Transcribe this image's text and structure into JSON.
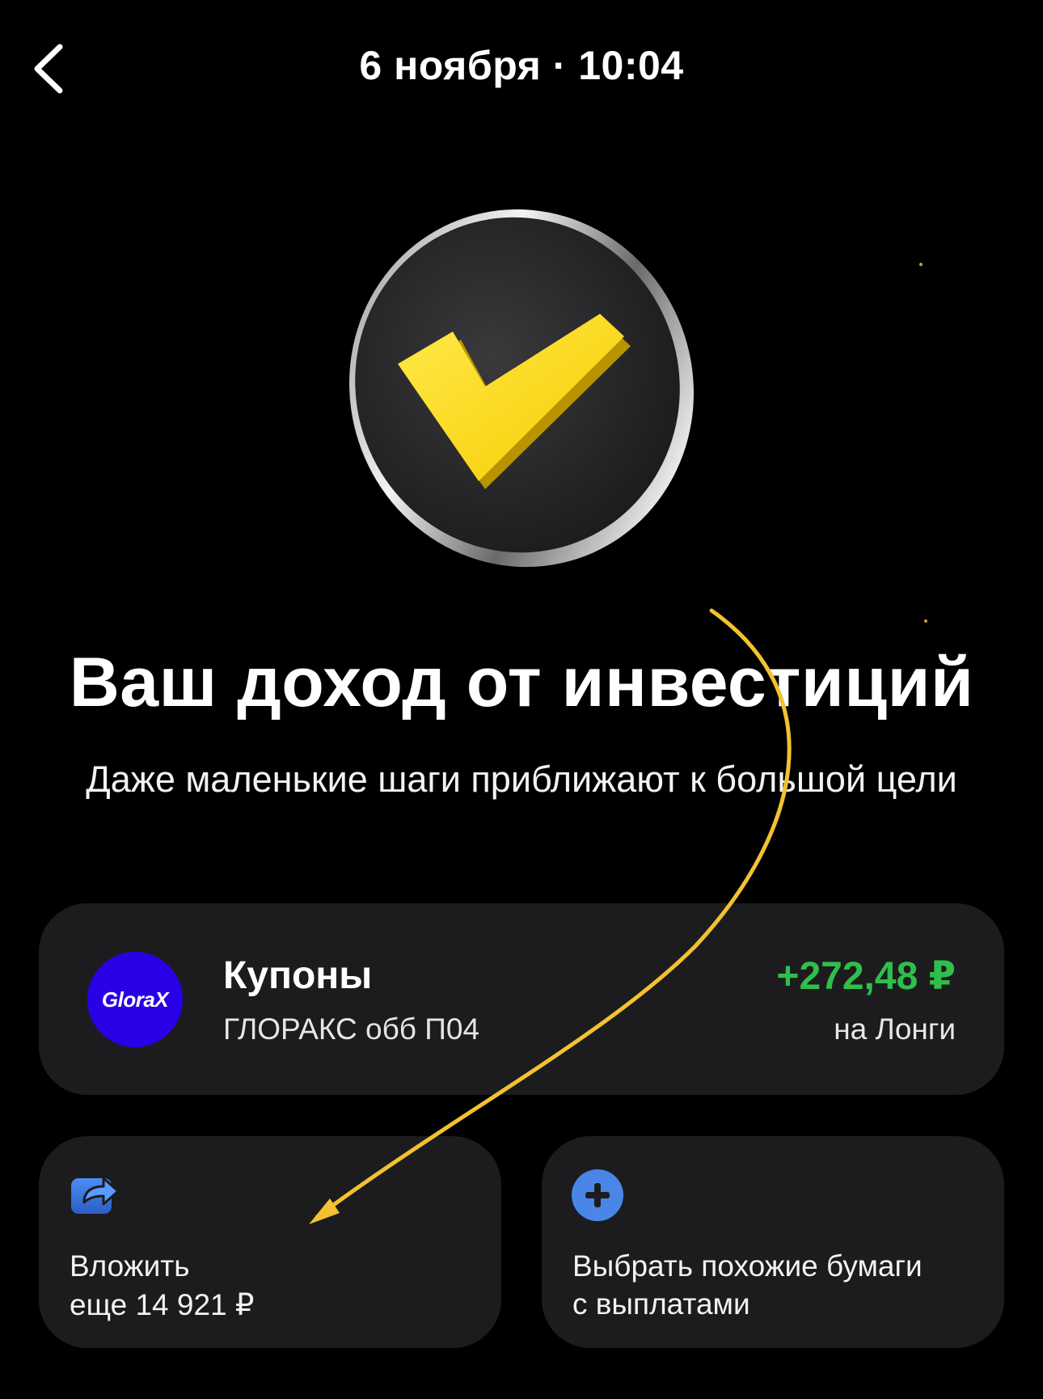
{
  "header": {
    "title": "6 ноября · 10:04",
    "back_icon": "chevron-left-icon"
  },
  "hero": {
    "icon": "yellow-checkmark-coin",
    "accent_color": "#ffdd2d"
  },
  "headline": "Ваш доход от инвестиций",
  "subtitle": "Даже маленькие шаги приближают к большой цели",
  "coupon": {
    "logo_text": "GloraX",
    "logo_color": "#2a00e6",
    "title": "Купоны",
    "bond": "ГЛОРАКС обб П04",
    "amount": "+272,48 ₽",
    "amount_color": "#2fbf4a",
    "account": "на Лонги"
  },
  "actions": {
    "invest": {
      "icon": "share-arrow-icon",
      "line1": "Вложить",
      "line2": "еще 14 921 ₽"
    },
    "choose": {
      "icon": "plus-circle-icon",
      "line1": "Выбрать похожие бумаги",
      "line2": "с выплатами"
    }
  },
  "annotation": {
    "color": "#f2c230"
  }
}
